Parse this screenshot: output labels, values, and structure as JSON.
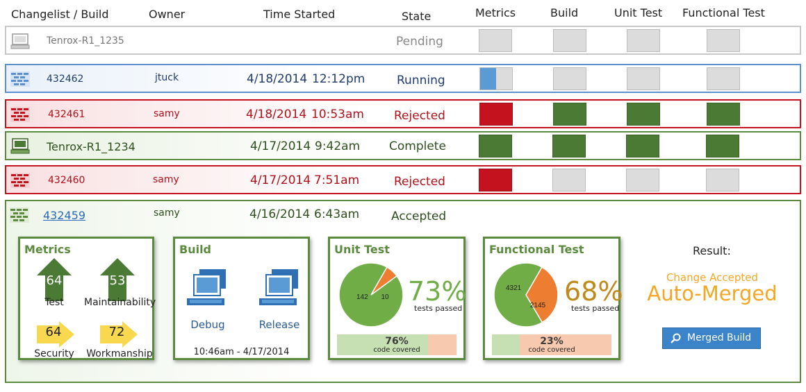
{
  "columns": {
    "changelist": "Changelist / Build",
    "owner": "Owner",
    "time": "Time Started",
    "state": "State",
    "metrics": "Metrics",
    "build": "Build",
    "unit_test": "Unit Test",
    "functional_test": "Functional Test"
  },
  "rows": [
    {
      "id": "Tenrox-R1_1235",
      "owner": "",
      "date": "",
      "time": "",
      "state": "Pending",
      "status": "pending",
      "metrics_progress": 0
    },
    {
      "id": "432462",
      "owner": "jtuck",
      "date": "4/18/2014",
      "time": "12:12pm",
      "state": "Running",
      "status": "running",
      "metrics_progress": 0.5
    },
    {
      "id": "432461",
      "owner": "samy",
      "date": "4/18/2014",
      "time": "10:53am",
      "state": "Rejected",
      "status": "rejected"
    },
    {
      "id": "Tenrox-R1_1234",
      "owner": "",
      "date": "4/17/2014",
      "time": "9:42am",
      "state": "Complete",
      "status": "complete"
    },
    {
      "id": "432460",
      "owner": "samy",
      "date": "4/17/2014",
      "time": "7:51am",
      "state": "Rejected",
      "status": "rejected"
    },
    {
      "id": "432459",
      "owner": "samy",
      "date": "4/16/2014",
      "time": "6:43am",
      "state": "Accepted",
      "status": "accepted"
    }
  ],
  "detail": {
    "metrics": {
      "title": "Metrics",
      "test_value": "64",
      "test_label": "Test",
      "maint_value": "53",
      "maint_label": "Maintainability",
      "security_value": "64",
      "security_label": "Security",
      "workmanship_value": "72",
      "workmanship_label": "Workmanship"
    },
    "build": {
      "title": "Build",
      "debug_label": "Debug",
      "release_label": "Release",
      "timestamp": "10:46am - 4/17/2014"
    },
    "unit_test": {
      "title": "Unit Test",
      "passed": "142",
      "failed": "10",
      "passed_count": 142,
      "failed_count": 10,
      "percent": "73%",
      "percent_label": "tests passed",
      "coverage": "76%",
      "coverage_value": 0.76,
      "coverage_label": "code covered"
    },
    "functional_test": {
      "title": "Functional Test",
      "passed": "4321",
      "failed": "2145",
      "passed_count": 4321,
      "failed_count": 2145,
      "percent": "68%",
      "percent_label": "tests passed",
      "coverage": "23%",
      "coverage_value": 0.23,
      "coverage_label": "code covered"
    },
    "result": {
      "label": "Result:",
      "status": "Change Accepted",
      "outcome": "Auto-Merged",
      "button_label": "Merged Build"
    }
  },
  "colors": {
    "green": "#4a7a34",
    "red": "#c4121f",
    "gray": "#dcdcdc",
    "running_blue": "#5b9bd5",
    "pie_green": "#70ad47",
    "pie_orange": "#ed7d31",
    "accent_orange": "#f5a623"
  },
  "icons": {
    "row_icon": "computer-icon",
    "row_icon_bricks": "brick-wall-icon",
    "button_icon": "magnifier-icon"
  }
}
